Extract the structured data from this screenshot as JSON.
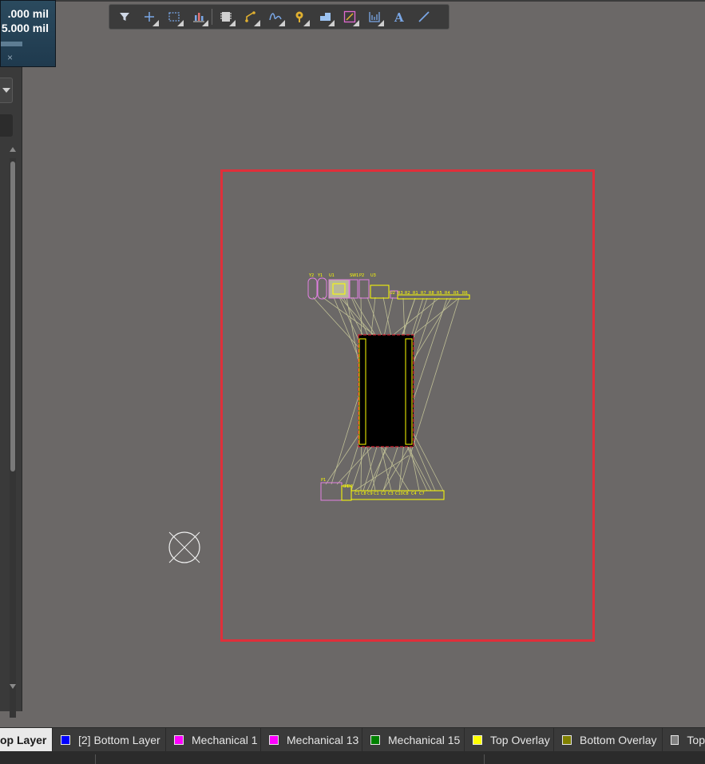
{
  "hud": {
    "x_coord": ".000 mil",
    "y_coord": "5.000 mil",
    "close": "×"
  },
  "toolbar": {
    "tools": [
      {
        "name": "filter-icon",
        "color": "#cfd8e6"
      },
      {
        "name": "crosshair-add-icon",
        "color": "#7aa7e6"
      },
      {
        "name": "select-rectangle-icon",
        "color": "#7aa7e6"
      },
      {
        "name": "align-icon",
        "color": "#7aa7e6"
      },
      {
        "name": "component-icon",
        "color": "#d0d0d0"
      },
      {
        "name": "route-track-icon",
        "color": "#e0b030"
      },
      {
        "name": "interactive-route-icon",
        "color": "#7aa7e6"
      },
      {
        "name": "via-pad-icon",
        "color": "#e0b030"
      },
      {
        "name": "polygon-pour-icon",
        "color": "#7aa7e6"
      },
      {
        "name": "dimension-icon",
        "color": "#e06ad0"
      },
      {
        "name": "keepout-icon",
        "color": "#7aa7e6"
      },
      {
        "name": "text-string-icon",
        "color": "#7aa7e6"
      },
      {
        "name": "line-icon",
        "color": "#7aa7e6"
      }
    ]
  },
  "pcb": {
    "components_top": [
      "Y2",
      "Y1",
      "U1",
      "SW1",
      "P2",
      "U3",
      "U2",
      "R3",
      "R2",
      "R1",
      "R7",
      "R8",
      "R5",
      "R4",
      "R5",
      "R6"
    ],
    "components_bottom": [
      "P1",
      "D1",
      "D2",
      "C1",
      "C8",
      "C9",
      "C1",
      "C2",
      "C3",
      "C10",
      "C8",
      "C4",
      "C7"
    ],
    "colors": {
      "board_outline": "#e02f3a",
      "overlay": "#ffff00",
      "ratsnest": "#c8c89a",
      "pad": "#e080e0"
    }
  },
  "layers": [
    {
      "label": "op Layer",
      "color": "#c00000",
      "active": true
    },
    {
      "label": "[2] Bottom Layer",
      "color": "#0000ff",
      "active": false
    },
    {
      "label": "Mechanical 1",
      "color": "#ff00ff",
      "active": false
    },
    {
      "label": "Mechanical 13",
      "color": "#ff00ff",
      "active": false
    },
    {
      "label": "Mechanical 15",
      "color": "#008000",
      "active": false
    },
    {
      "label": "Top Overlay",
      "color": "#ffff00",
      "active": false
    },
    {
      "label": "Bottom Overlay",
      "color": "#808000",
      "active": false
    },
    {
      "label": "Top",
      "color": "#808080",
      "active": false
    }
  ]
}
